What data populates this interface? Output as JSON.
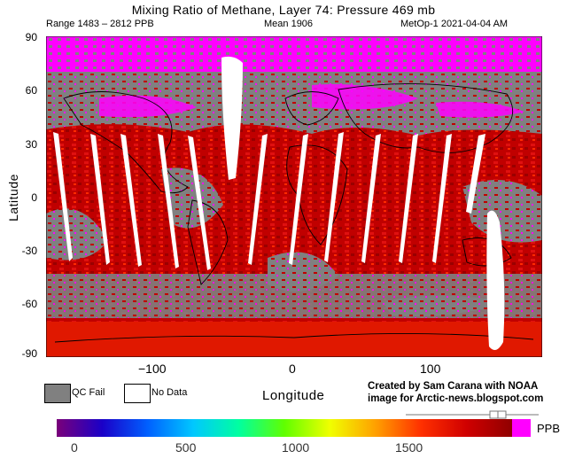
{
  "header": {
    "title": "Mixing Ratio of Methane, Layer 74: Pressure 469 mb",
    "range": "Range 1483 – 2812 PPB",
    "mean": "Mean 1906",
    "source": "MetOp-1 2021-04-04 AM"
  },
  "axes": {
    "y_label": "Latitude",
    "x_label": "Longitude",
    "y_ticks": [
      "90",
      "60",
      "30",
      "0",
      "-30",
      "-60",
      "-90"
    ],
    "x_ticks": [
      "−100",
      "0",
      "100"
    ]
  },
  "legend": {
    "qc_fail": "QC Fail",
    "no_data": "No Data",
    "qc_fail_color": "#808080",
    "no_data_color": "#ffffff"
  },
  "credit": {
    "line1": "Created by Sam Carana with NOAA",
    "line2": "image for Arctic-news.blogspot.com"
  },
  "colorbar": {
    "ticks": [
      "0",
      "500",
      "1000",
      "1500"
    ],
    "unit": "PPB",
    "colors": [
      "#7a007a",
      "#1a00c8",
      "#0060ff",
      "#00c8ff",
      "#00ffa0",
      "#60ff00",
      "#f0ff00",
      "#ffa000",
      "#ff3000",
      "#d00000",
      "#900000"
    ],
    "over_color": "#ff00ff"
  }
}
